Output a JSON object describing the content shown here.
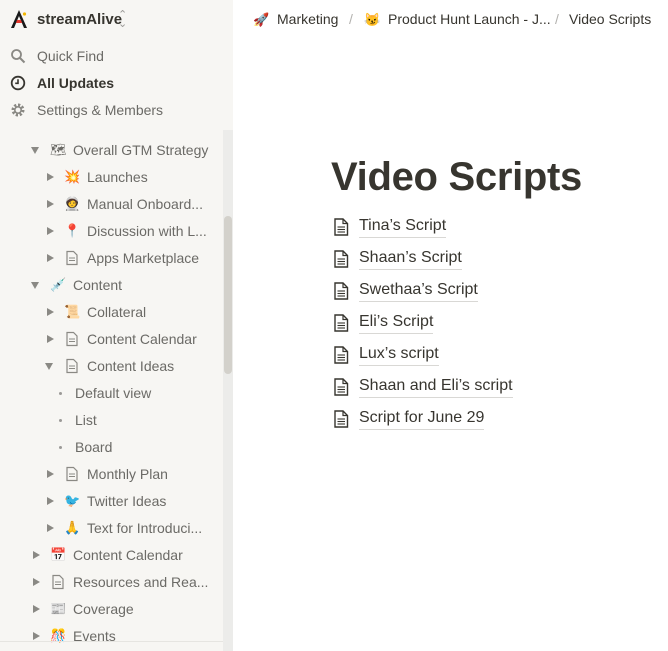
{
  "workspace": {
    "name": "streamAlive"
  },
  "nav": {
    "quick_find": "Quick Find",
    "all_updates": "All Updates",
    "settings": "Settings & Members"
  },
  "tree": [
    {
      "label": "Overall GTM Strategy",
      "icon": "map-emoji",
      "state": "open"
    },
    {
      "label": "Launches",
      "icon": "explosion-emoji",
      "state": "closed"
    },
    {
      "label": "Manual Onboard...",
      "icon": "astronaut-emoji",
      "state": "closed"
    },
    {
      "label": "Discussion with L...",
      "icon": "pushpin-emoji",
      "state": "closed"
    },
    {
      "label": "Apps Marketplace",
      "icon": "page-icon",
      "state": "closed"
    },
    {
      "label": "Content",
      "icon": "syringe-emoji",
      "state": "open"
    },
    {
      "label": "Collateral",
      "icon": "scroll-emoji",
      "state": "closed"
    },
    {
      "label": "Content Calendar",
      "icon": "page-icon",
      "state": "closed"
    },
    {
      "label": "Content Ideas",
      "icon": "page-icon",
      "state": "open"
    },
    {
      "label": "Default view",
      "icon": "bullet",
      "state": "view"
    },
    {
      "label": "List",
      "icon": "bullet",
      "state": "view"
    },
    {
      "label": "Board",
      "icon": "bullet",
      "state": "view"
    },
    {
      "label": "Monthly Plan",
      "icon": "page-icon",
      "state": "closed"
    },
    {
      "label": "Twitter Ideas",
      "icon": "bird-emoji",
      "state": "closed"
    },
    {
      "label": "Text for Introduci...",
      "icon": "folded-hands-emoji",
      "state": "closed"
    },
    {
      "label": "Content Calendar",
      "icon": "calendar-emoji",
      "state": "closed"
    },
    {
      "label": "Resources and Rea...",
      "icon": "page-icon",
      "state": "closed"
    },
    {
      "label": "Coverage",
      "icon": "newspaper-emoji",
      "state": "closed"
    },
    {
      "label": "Events",
      "icon": "party-emoji",
      "state": "closed"
    }
  ],
  "breadcrumb": {
    "item1": "Marketing",
    "item2": "Product Hunt Launch - J...",
    "item3": "Video Scripts",
    "separator": "/"
  },
  "page": {
    "title": "Video Scripts",
    "links": [
      "Tina’s Script",
      "Shaan’s Script",
      "Swethaa’s Script",
      "Eli’s Script",
      "Lux’s script",
      "Shaan and Eli’s script",
      "Script for June 29"
    ]
  },
  "colors": {
    "sidebar_bg": "#f7f6f3",
    "text": "#37352f",
    "muted": "#6b6a66"
  }
}
